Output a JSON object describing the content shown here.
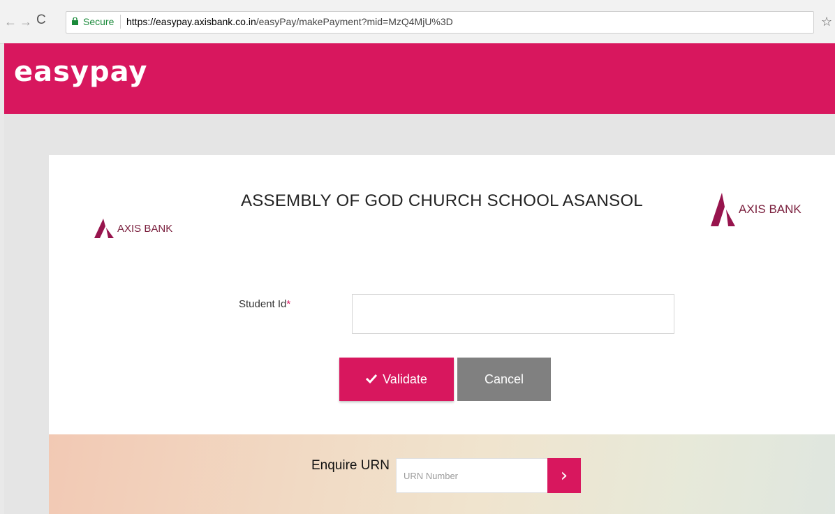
{
  "browser": {
    "back_icon": "←",
    "forward_icon": "→",
    "reload_icon": "C",
    "secure_label": "Secure",
    "url_host": "https://easypay.axisbank.co.in",
    "url_path": "/easyPay/makePayment?mid=MzQ4MjU%3D",
    "bookmark_icon": "☆"
  },
  "header": {
    "logo_text": "easypay",
    "background_color": "#d8175e"
  },
  "card": {
    "school_name": "ASSEMBLY OF GOD CHURCH SCHOOL ASANSOL",
    "bank_logo_left": "AXIS BANK",
    "bank_logo_right": "AXIS BANK",
    "bank_color": "#97144d"
  },
  "form": {
    "student_id_label": "Student Id",
    "required_marker": "*",
    "student_id_value": "",
    "validate_label": "Validate",
    "cancel_label": "Cancel"
  },
  "urn": {
    "label": "Enquire URN",
    "placeholder": "URN Number",
    "submit_icon": "›"
  }
}
